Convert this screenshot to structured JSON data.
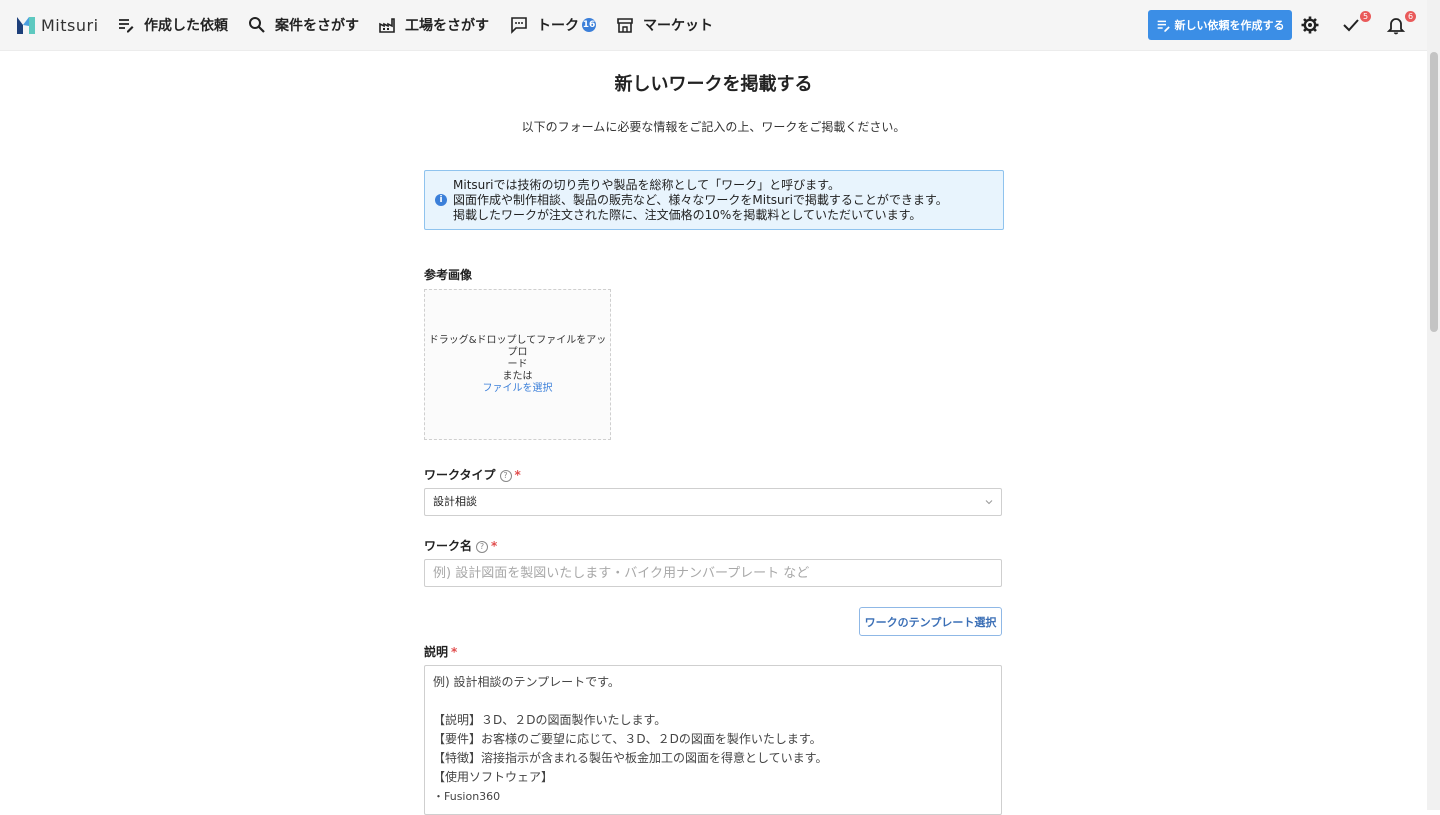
{
  "brand": {
    "name": "Mitsuri"
  },
  "nav": {
    "items": [
      {
        "label": "作成した依頼",
        "icon": "list-edit-icon"
      },
      {
        "label": "案件をさがす",
        "icon": "search-icon"
      },
      {
        "label": "工場をさがす",
        "icon": "factory-icon"
      },
      {
        "label": "トーク",
        "icon": "chat-icon",
        "badge": "16"
      },
      {
        "label": "マーケット",
        "icon": "store-icon"
      }
    ],
    "new_request_label": "新しい依頼を作成する",
    "tasks_count": "5",
    "notifications_count": "6"
  },
  "page": {
    "title": "新しいワークを掲載する",
    "subtitle": "以下のフォームに必要な情報をご記入の上、ワークをご掲載ください。"
  },
  "info": {
    "lines": [
      "Mitsuriでは技術の切り売りや製品を総称として「ワーク」と呼びます。",
      "図面作成や制作相談、製品の販売など、様々なワークをMitsuriで掲載することができます。",
      "掲載したワークが注文された際に、注文価格の10%を掲載料としていただいています。"
    ]
  },
  "form": {
    "image": {
      "label": "参考画像",
      "drop_text_1": "ドラッグ&ドロップしてファイルをアップロ",
      "drop_text_2": "ード",
      "or_text": "または",
      "select_link": "ファイルを選択"
    },
    "work_type": {
      "label": "ワークタイプ",
      "value": "設計相談"
    },
    "work_name": {
      "label": "ワーク名",
      "placeholder": "例) 設計図面を製図いたします・バイク用ナンバープレート など"
    },
    "template_button": "ワークのテンプレート選択",
    "description": {
      "label": "説明",
      "lines": [
        "例) 設計相談のテンプレートです。",
        "",
        "【説明】３D、２Dの図面製作いたします。",
        "【要件】お客様のご要望に応じて、３D、２Dの図面を製作いたします。",
        "【特徴】溶接指示が含まれる製缶や板金加工の図面を得意としています。",
        "【使用ソフトウェア】",
        "・Fusion360"
      ]
    },
    "required_mark": "*",
    "help_mark": "?"
  },
  "colors": {
    "accent": "#3b8ee6",
    "required": "#e14d4d",
    "info_bg": "#e8f4fd",
    "badge": "#e95a5a"
  }
}
